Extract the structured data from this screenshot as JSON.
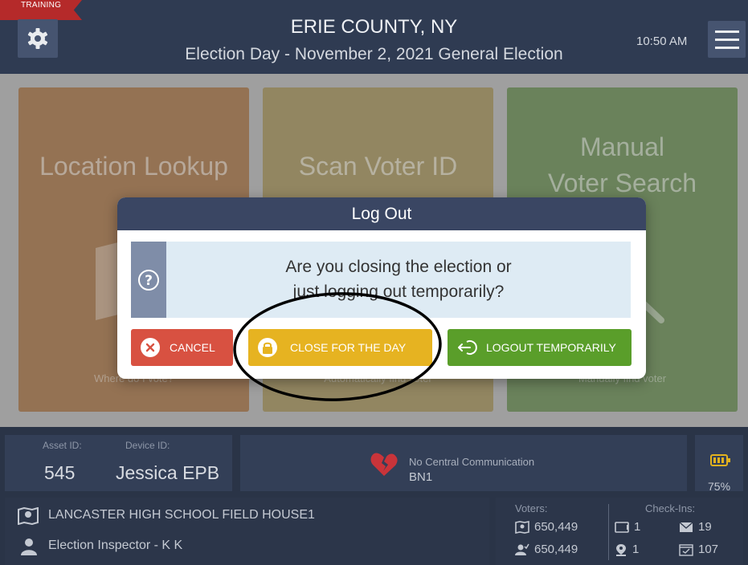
{
  "header": {
    "training_label": "TRAINING",
    "county": "ERIE COUNTY, NY",
    "election": "Election Day - November 2, 2021 General Election",
    "time": "10:50 AM"
  },
  "tiles": {
    "location_lookup": {
      "title": "Location Lookup",
      "subtitle": "Where do I vote?"
    },
    "scan_voter_id": {
      "title": "Scan Voter ID",
      "subtitle": "Automatically find voter"
    },
    "manual_search": {
      "title_line1": "Manual",
      "title_line2": "Voter Search",
      "subtitle": "Manually find voter"
    }
  },
  "modal": {
    "title": "Log Out",
    "message_line1": "Are you closing the election or",
    "message_line2": "just logging out temporarily?",
    "cancel_label": "CANCEL",
    "close_label": "CLOSE FOR THE DAY",
    "logout_label": "LOGOUT TEMPORARILY"
  },
  "footer": {
    "asset_label": "Asset ID:",
    "asset_value": "545",
    "device_label": "Device ID:",
    "device_value": "Jessica EPB",
    "comm_status": "No Central Communication",
    "comm_code": "BN1",
    "battery": "75%",
    "location": "LANCASTER HIGH SCHOOL FIELD HOUSE1",
    "role": "Election Inspector - K K",
    "voters_label": "Voters:",
    "voters_count_1": "650,449",
    "voters_count_2": "650,449",
    "checkins_label": "Check-Ins:",
    "checkin_a": "1",
    "checkin_b": "19",
    "checkin_c": "1",
    "checkin_d": "107"
  },
  "colors": {
    "header_bg": "#2f3b52",
    "cancel": "#d85141",
    "close_for_day": "#e6b321",
    "logout": "#5a9e2a",
    "training_banner": "#b52a2a"
  }
}
